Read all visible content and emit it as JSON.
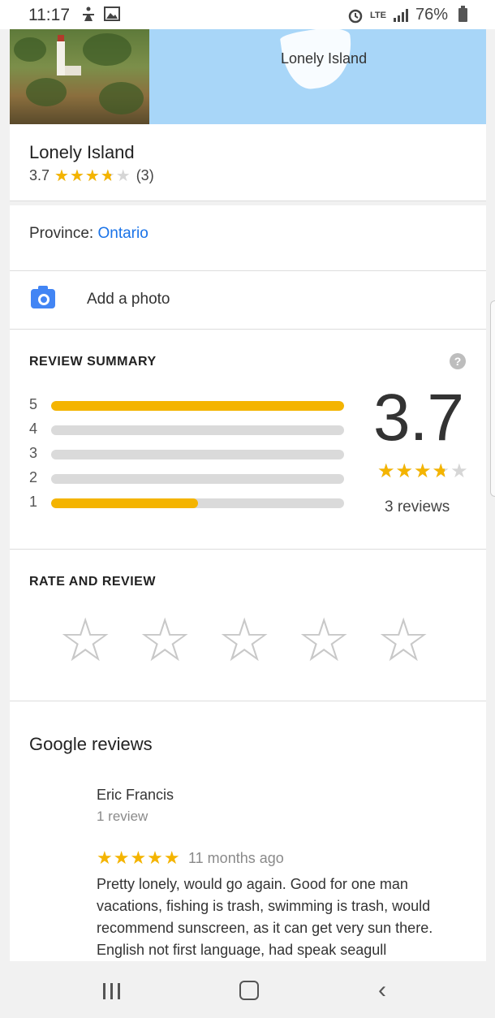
{
  "status_bar": {
    "time": "11:17",
    "network": "LTE",
    "battery": "76%"
  },
  "hero": {
    "map_label": "Lonely Island"
  },
  "place": {
    "name": "Lonely Island",
    "rating": "3.7",
    "rating_value": 3.7,
    "review_count_short": "(3)"
  },
  "province": {
    "label": "Province:",
    "value": "Ontario"
  },
  "add_photo": {
    "label": "Add a photo",
    "icon": "camera-icon"
  },
  "review_summary": {
    "title": "REVIEW SUMMARY",
    "help_icon": "?",
    "bars": [
      {
        "stars": "5",
        "fraction": 1.0
      },
      {
        "stars": "4",
        "fraction": 0.0
      },
      {
        "stars": "3",
        "fraction": 0.0
      },
      {
        "stars": "2",
        "fraction": 0.0
      },
      {
        "stars": "1",
        "fraction": 0.5
      }
    ],
    "score": "3.7",
    "score_value": 3.7,
    "reviews_label": "3 reviews"
  },
  "rate_and_review": {
    "title": "RATE AND REVIEW",
    "stars": 5
  },
  "google_reviews": {
    "title": "Google reviews",
    "reviews": [
      {
        "author": "Eric Francis",
        "author_reviews": "1 review",
        "rating": 5,
        "time": "11 months ago",
        "text": "Pretty lonely, would go again. Good for one man vacations, fishing is trash, swimming is trash, would recommend sunscreen, as it can get very sun there. English not first language, had speak seagull"
      }
    ]
  },
  "colors": {
    "star": "#f4b400",
    "link": "#1a73e8",
    "map_water": "#a8d6f8",
    "camera": "#4285f4"
  }
}
